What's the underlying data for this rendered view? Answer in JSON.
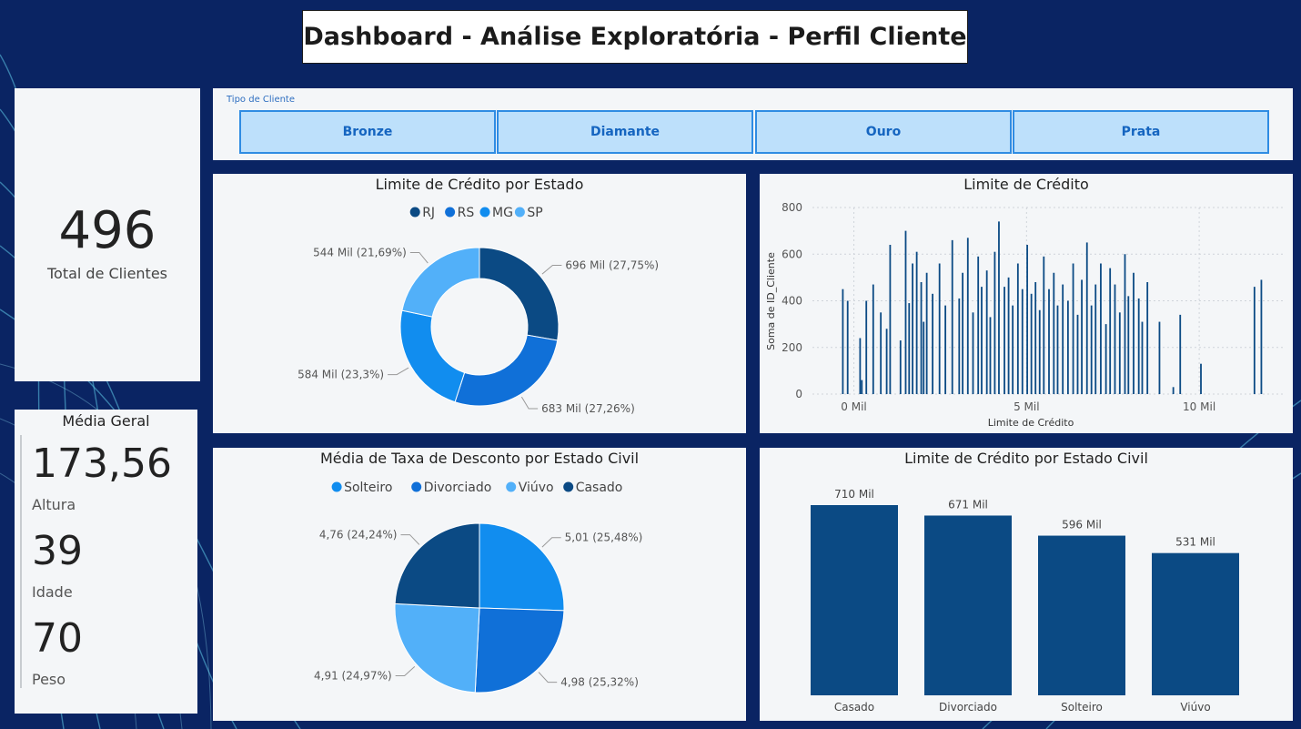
{
  "header": {
    "title": "Dashboard - Análise Exploratória - Perfil Cliente"
  },
  "kpi_total": {
    "value": "496",
    "label": "Total de Clientes"
  },
  "media_geral": {
    "title": "Média Geral",
    "items": [
      {
        "value": "173,56",
        "label": "Altura"
      },
      {
        "value": "39",
        "label": "Idade"
      },
      {
        "value": "70",
        "label": "Peso"
      }
    ]
  },
  "slicer": {
    "label": "Tipo de Cliente",
    "options": [
      "Bronze",
      "Diamante",
      "Ouro",
      "Prata"
    ]
  },
  "colors": {
    "background": "#0a2463",
    "panel": "#f4f6f8",
    "dark": "#0b4a84",
    "mid": "#1070d8",
    "bright": "#118def",
    "light": "#52b0f9"
  },
  "chart_data": [
    {
      "type": "pie",
      "donut": true,
      "title": "Limite de Crédito por Estado",
      "legend_position": "top",
      "slices": [
        {
          "name": "RJ",
          "value": 696,
          "label": "696 Mil (27,75%)",
          "color": "#0b4a84"
        },
        {
          "name": "RS",
          "value": 683,
          "label": "683 Mil (27,26%)",
          "color": "#1070d8"
        },
        {
          "name": "MG",
          "value": 584,
          "label": "584 Mil (23,3%)",
          "color": "#118def"
        },
        {
          "name": "SP",
          "value": 544,
          "label": "544 Mil (21,69%)",
          "color": "#52b0f9"
        }
      ]
    },
    {
      "type": "bar",
      "title": "Limite de Crédito",
      "xlabel": "Limite de Crédito",
      "ylabel": "Soma de ID_Cliente",
      "ylim": [
        0,
        800
      ],
      "yticks": [
        "0",
        "200",
        "400",
        "600",
        "800"
      ],
      "xticks": [
        "0 Mil",
        "5 Mil",
        "10 Mil"
      ],
      "xtick_values": [
        0,
        5000,
        10000
      ],
      "xlim": [
        -1200,
        12500
      ],
      "grid": true,
      "color": "#0b4a84",
      "x": [
        -320,
        -180,
        180,
        230,
        360,
        560,
        780,
        950,
        1050,
        1350,
        1500,
        1600,
        1700,
        1820,
        1950,
        2020,
        2110,
        2280,
        2480,
        2650,
        2850,
        3050,
        3150,
        3300,
        3450,
        3600,
        3700,
        3850,
        3950,
        4080,
        4200,
        4360,
        4480,
        4600,
        4750,
        4880,
        5020,
        5140,
        5260,
        5380,
        5500,
        5650,
        5790,
        5900,
        6050,
        6200,
        6350,
        6480,
        6600,
        6750,
        6880,
        7000,
        7150,
        7300,
        7420,
        7560,
        7700,
        7850,
        7950,
        8100,
        8250,
        8350,
        8500,
        8850,
        9250,
        9450,
        10050,
        11600,
        11800
      ],
      "values": [
        450,
        400,
        240,
        60,
        400,
        470,
        350,
        280,
        640,
        230,
        700,
        390,
        560,
        610,
        480,
        310,
        520,
        430,
        560,
        380,
        660,
        410,
        520,
        670,
        350,
        590,
        460,
        530,
        330,
        610,
        740,
        460,
        500,
        380,
        560,
        450,
        640,
        430,
        480,
        360,
        590,
        450,
        520,
        380,
        470,
        400,
        560,
        340,
        490,
        650,
        380,
        470,
        560,
        300,
        540,
        470,
        350,
        600,
        420,
        520,
        410,
        310,
        480,
        310,
        30,
        340,
        130,
        460,
        490
      ]
    },
    {
      "type": "pie",
      "title": "Média de Taxa de Desconto por Estado Civil",
      "legend_position": "top",
      "slices": [
        {
          "name": "Solteiro",
          "value": 5.01,
          "label": "5,01 (25,48%)",
          "color": "#118def"
        },
        {
          "name": "Divorciado",
          "value": 4.98,
          "label": "4,98 (25,32%)",
          "color": "#1070d8"
        },
        {
          "name": "Viúvo",
          "value": 4.91,
          "label": "4,91 (24,97%)",
          "color": "#52b0f9"
        },
        {
          "name": "Casado",
          "value": 4.76,
          "label": "4,76 (24,24%)",
          "color": "#0b4a84"
        }
      ]
    },
    {
      "type": "bar",
      "title": "Limite de Crédito por Estado Civil",
      "categories": [
        "Casado",
        "Divorciado",
        "Solteiro",
        "Viúvo"
      ],
      "values": [
        710,
        671,
        596,
        531
      ],
      "data_labels": [
        "710 Mil",
        "671 Mil",
        "596 Mil",
        "531 Mil"
      ],
      "ylim": [
        0,
        710
      ],
      "color": "#0b4a84"
    }
  ]
}
